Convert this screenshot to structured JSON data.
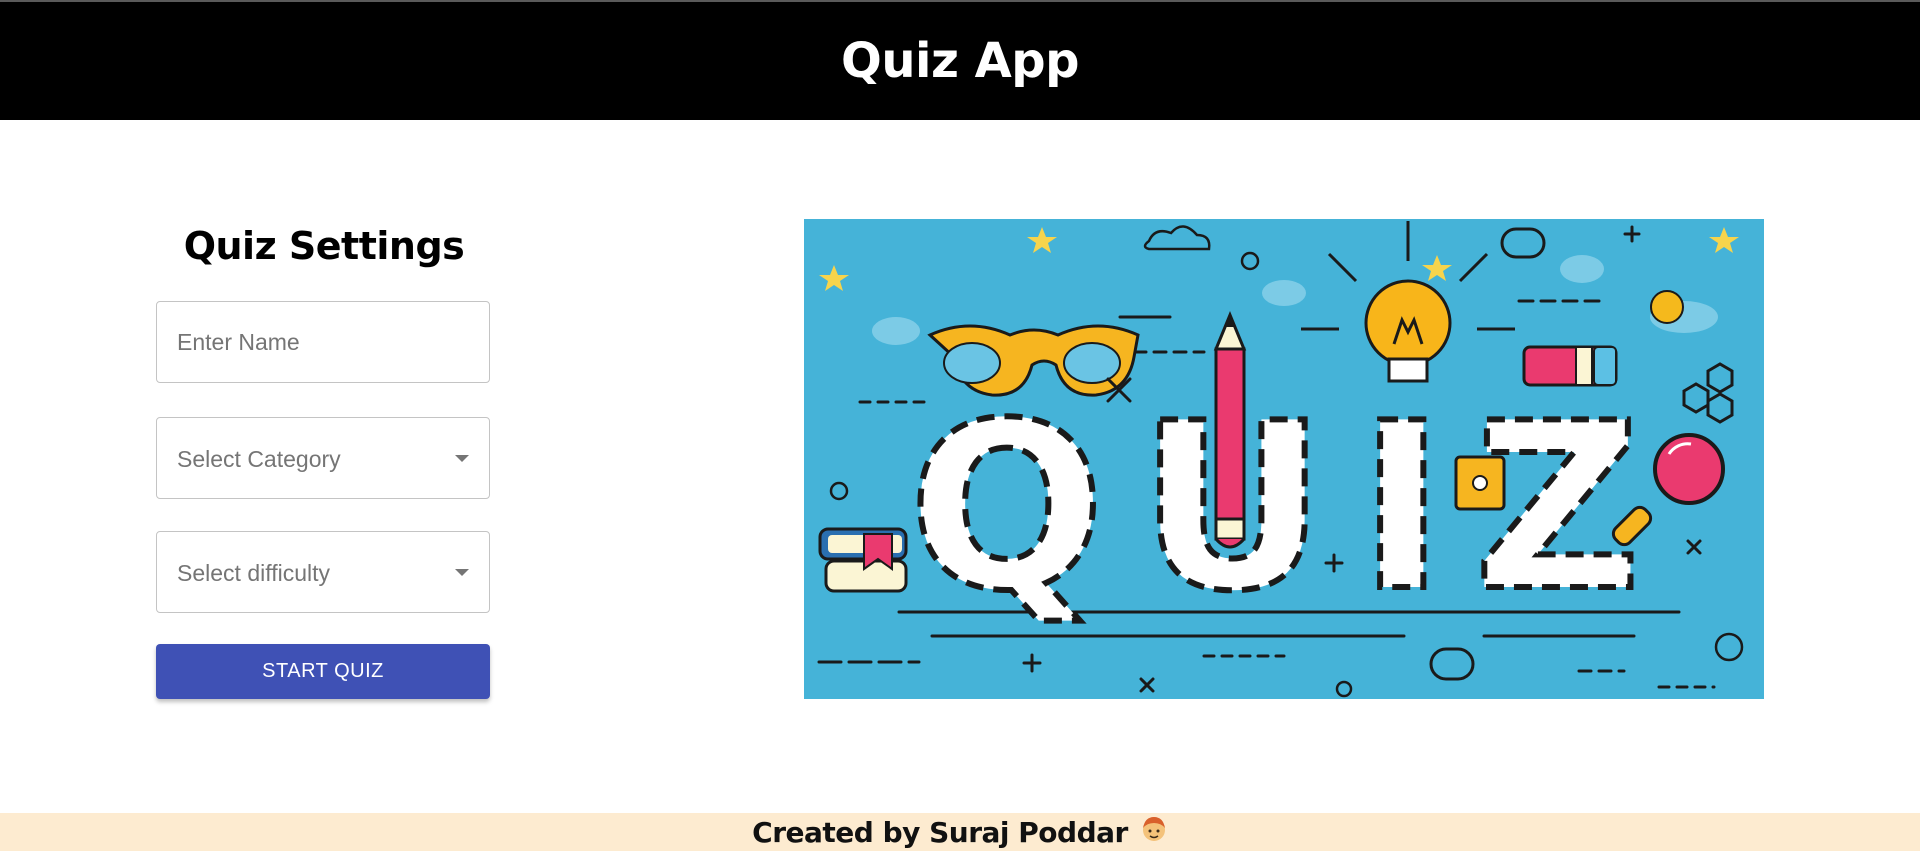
{
  "header": {
    "title": "Quiz App"
  },
  "settings": {
    "title": "Quiz Settings",
    "name_input": {
      "placeholder": "Enter Name",
      "value": ""
    },
    "category_select": {
      "selected": "Select Category"
    },
    "difficulty_select": {
      "selected": "Select difficulty"
    },
    "start_label": "START QUIZ"
  },
  "banner": {
    "image_icon": "quiz-illustration",
    "word": "QUIZ"
  },
  "footer": {
    "credit": "Created by Suraj Poddar",
    "emoji_icon": "person-face-icon"
  },
  "colors": {
    "header_bg": "#000000",
    "button": "#3f51b5",
    "banner_bg": "#45b3d8",
    "footer_bg": "#fdebd0"
  }
}
